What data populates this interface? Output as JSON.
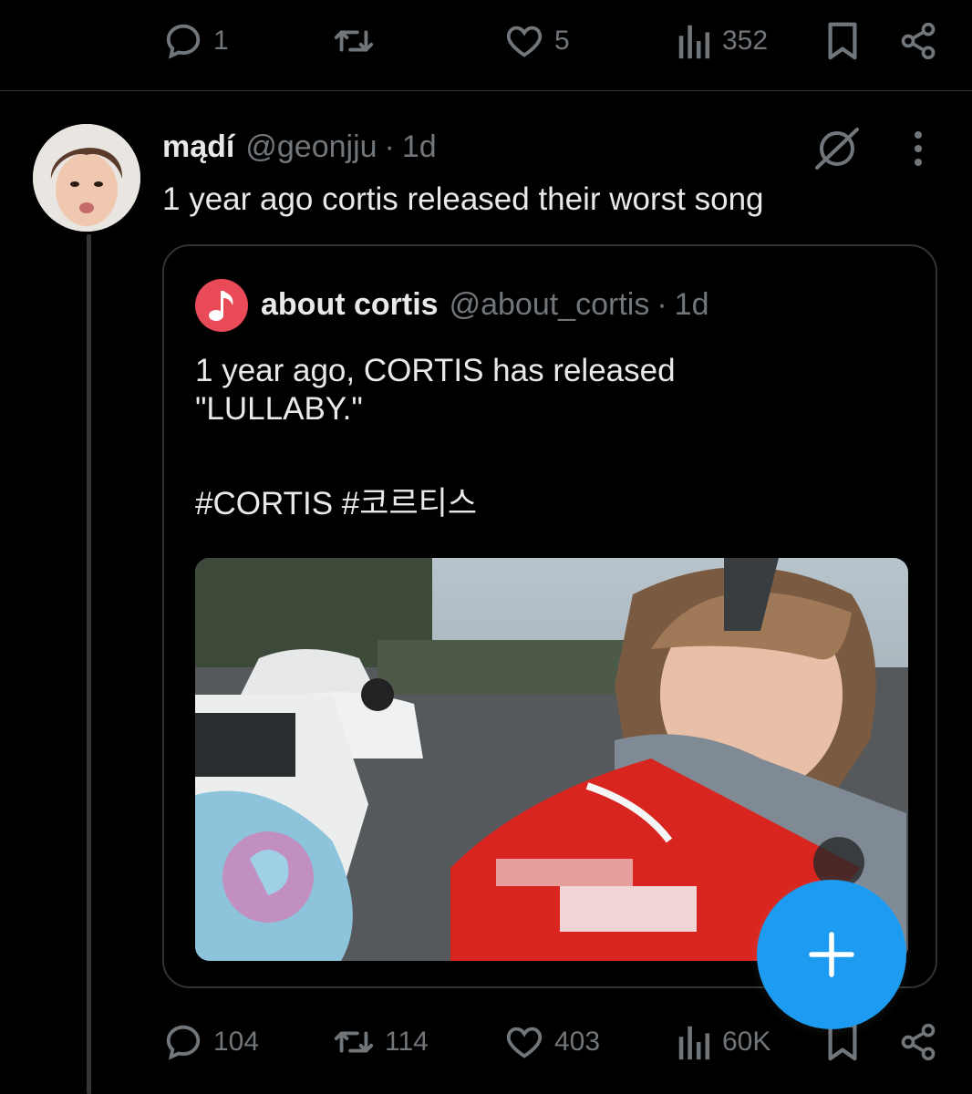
{
  "previous_tweet": {
    "actions": {
      "replies": "1",
      "reposts": "",
      "likes": "5",
      "views": "352"
    }
  },
  "tweet": {
    "author": {
      "name": "mądí",
      "handle": "@geonjju",
      "separator": "·",
      "time": "1d"
    },
    "text": "1 year ago cortis released their worst song",
    "icons": [
      "grok-icon",
      "more-icon"
    ],
    "quoted": {
      "author": {
        "name": "about cortis",
        "handle": "@about_cortis",
        "separator": "·",
        "time": "1d"
      },
      "text_lines": [
        "1 year ago, CORTIS has released",
        "\"LULLABY.\"",
        "#CORTIS #코르티스"
      ],
      "media": "video"
    },
    "actions": {
      "replies": "104",
      "reposts": "114",
      "likes": "403",
      "views": "60K"
    }
  },
  "fab": {
    "icon": "plus-icon",
    "color": "#1d9bf0"
  },
  "colors": {
    "background": "#000000",
    "text": "#e7e9ea",
    "muted": "#71767b",
    "border": "#2f3336"
  }
}
